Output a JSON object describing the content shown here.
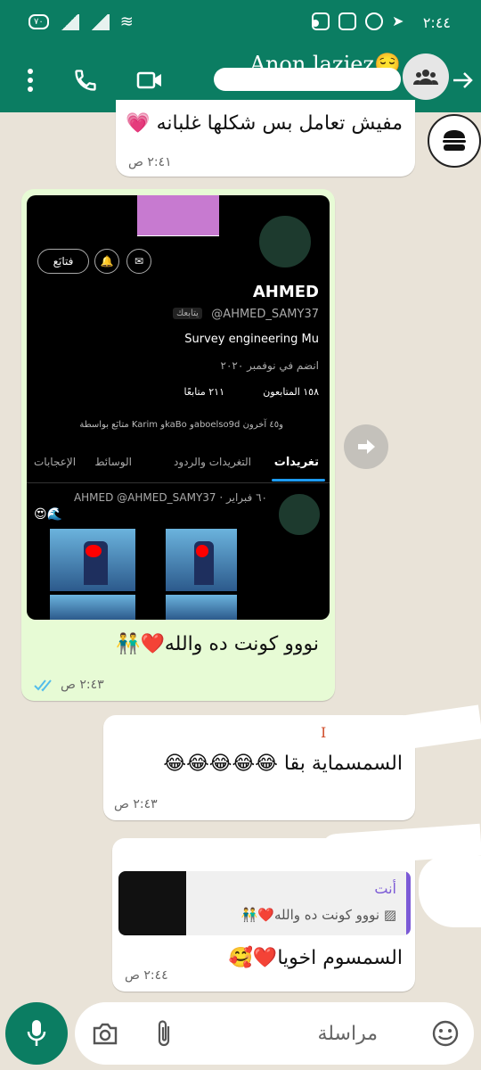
{
  "status_bar": {
    "time": "٢:٤٤",
    "battery": "٧٠"
  },
  "header": {
    "title": "Anon laziez😌"
  },
  "messages": {
    "m1": {
      "text": "مفيش تعامل بس شكلها غلبانه 💗",
      "time": "٢:٤١ ص"
    },
    "m2": {
      "caption": "نووو كونت ده والله❤️👬",
      "time": "٢:٤٣ ص",
      "screenshot": {
        "name": "AHMED",
        "handle": "@AHMED_SAMY37",
        "follows_you": "يتابعك",
        "bio": "Survey engineering Mu",
        "joined": "انضم في نوفمبر ٢٠٢٠",
        "followers": "١٥٨ المتابعون",
        "following": "٢١١ متابعًا",
        "followed_by": "متابَع بواسطة Karim وkaBo وaboelso9d و٤٥ آخرون",
        "follow_button": "فتابَع",
        "tabs": [
          "تغريدات",
          "التغريدات والردود",
          "الوسائط",
          "الإعجابات"
        ],
        "tweet_header": "AHMED @AHMED_SAMY37 · ٦٠ فبراير",
        "tweet_text": "😍🌊"
      }
    },
    "m3": {
      "text": "السمسماية بقا 😂😂😂😂😂",
      "time": "٢:٤٣ ص",
      "marker": "I"
    },
    "m4": {
      "quote_author": "أنت",
      "quote_text": "نووو كونت ده والله❤️👬",
      "text": "السمسوم اخويا❤️🥰",
      "time": "٢:٤٤ ص"
    }
  },
  "composer": {
    "placeholder": "مراسلة"
  }
}
